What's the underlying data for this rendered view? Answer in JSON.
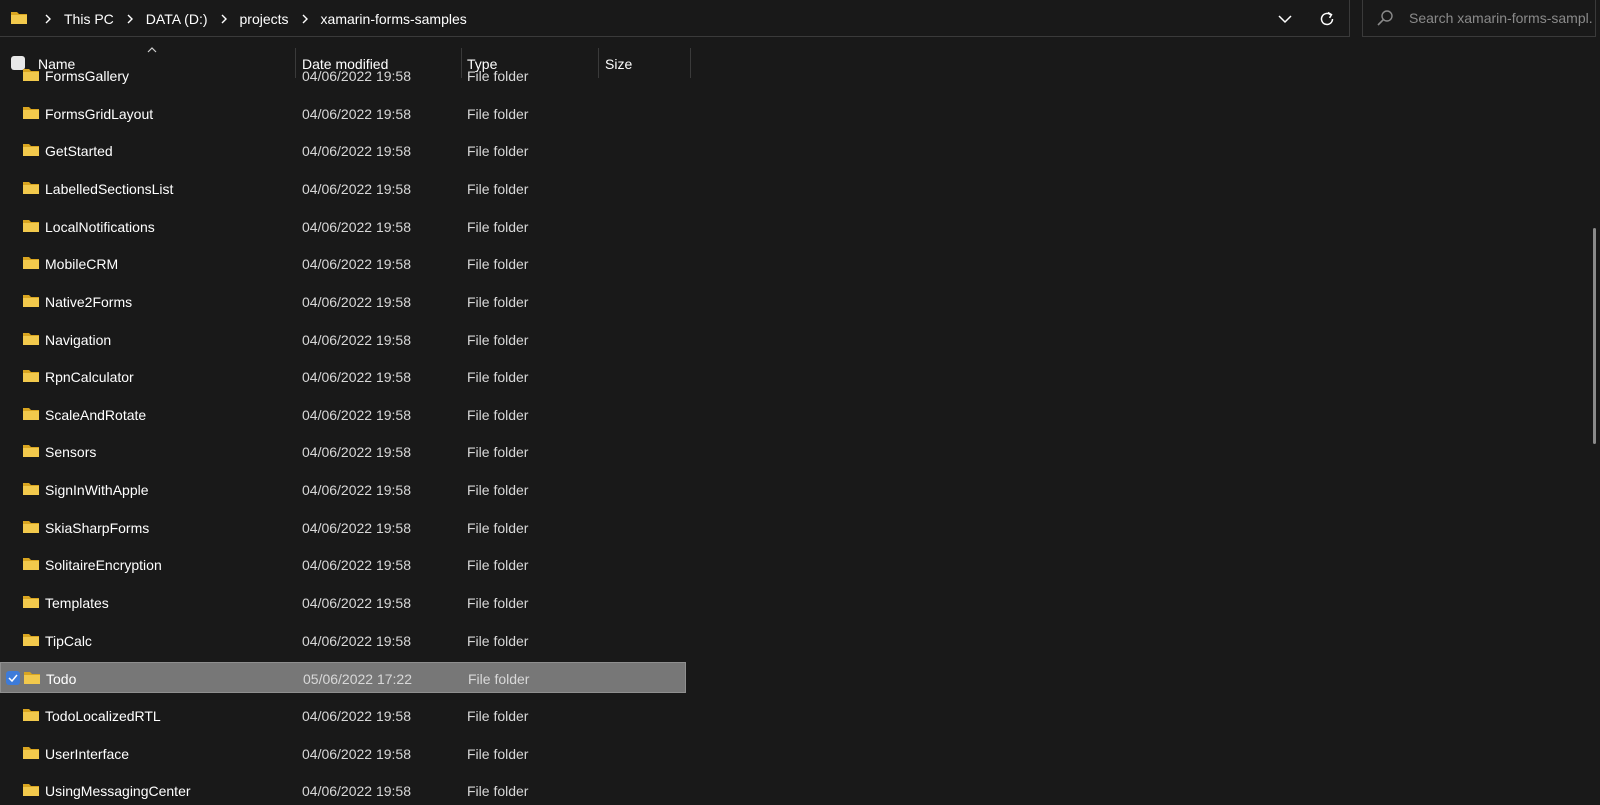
{
  "address": {
    "crumbs": [
      "This PC",
      "DATA (D:)",
      "projects",
      "xamarin-forms-samples"
    ]
  },
  "search": {
    "placeholder": "Search xamarin-forms-sampl..."
  },
  "columns": {
    "name": "Name",
    "date": "Date modified",
    "type": "Type",
    "size": "Size"
  },
  "rows": [
    {
      "name": "FormsGallery",
      "date": "04/06/2022 19:58",
      "type": "File folder"
    },
    {
      "name": "FormsGridLayout",
      "date": "04/06/2022 19:58",
      "type": "File folder"
    },
    {
      "name": "GetStarted",
      "date": "04/06/2022 19:58",
      "type": "File folder"
    },
    {
      "name": "LabelledSectionsList",
      "date": "04/06/2022 19:58",
      "type": "File folder"
    },
    {
      "name": "LocalNotifications",
      "date": "04/06/2022 19:58",
      "type": "File folder"
    },
    {
      "name": "MobileCRM",
      "date": "04/06/2022 19:58",
      "type": "File folder"
    },
    {
      "name": "Native2Forms",
      "date": "04/06/2022 19:58",
      "type": "File folder"
    },
    {
      "name": "Navigation",
      "date": "04/06/2022 19:58",
      "type": "File folder"
    },
    {
      "name": "RpnCalculator",
      "date": "04/06/2022 19:58",
      "type": "File folder"
    },
    {
      "name": "ScaleAndRotate",
      "date": "04/06/2022 19:58",
      "type": "File folder"
    },
    {
      "name": "Sensors",
      "date": "04/06/2022 19:58",
      "type": "File folder"
    },
    {
      "name": "SignInWithApple",
      "date": "04/06/2022 19:58",
      "type": "File folder"
    },
    {
      "name": "SkiaSharpForms",
      "date": "04/06/2022 19:58",
      "type": "File folder"
    },
    {
      "name": "SolitaireEncryption",
      "date": "04/06/2022 19:58",
      "type": "File folder"
    },
    {
      "name": "Templates",
      "date": "04/06/2022 19:58",
      "type": "File folder"
    },
    {
      "name": "TipCalc",
      "date": "04/06/2022 19:58",
      "type": "File folder"
    },
    {
      "name": "Todo",
      "date": "05/06/2022 17:22",
      "type": "File folder",
      "selected": true
    },
    {
      "name": "TodoLocalizedRTL",
      "date": "04/06/2022 19:58",
      "type": "File folder"
    },
    {
      "name": "UserInterface",
      "date": "04/06/2022 19:58",
      "type": "File folder"
    },
    {
      "name": "UsingMessagingCenter",
      "date": "04/06/2022 19:58",
      "type": "File folder"
    }
  ],
  "icons": {
    "folder": "folder-icon",
    "search": "search-icon",
    "refresh": "refresh-icon",
    "dropdown": "chevron-down-icon",
    "chevron": "chevron-right-icon"
  },
  "colors": {
    "folder": "#F2C94C",
    "selected_bg": "#777777",
    "checkbox_accent": "#3D7BD9"
  }
}
